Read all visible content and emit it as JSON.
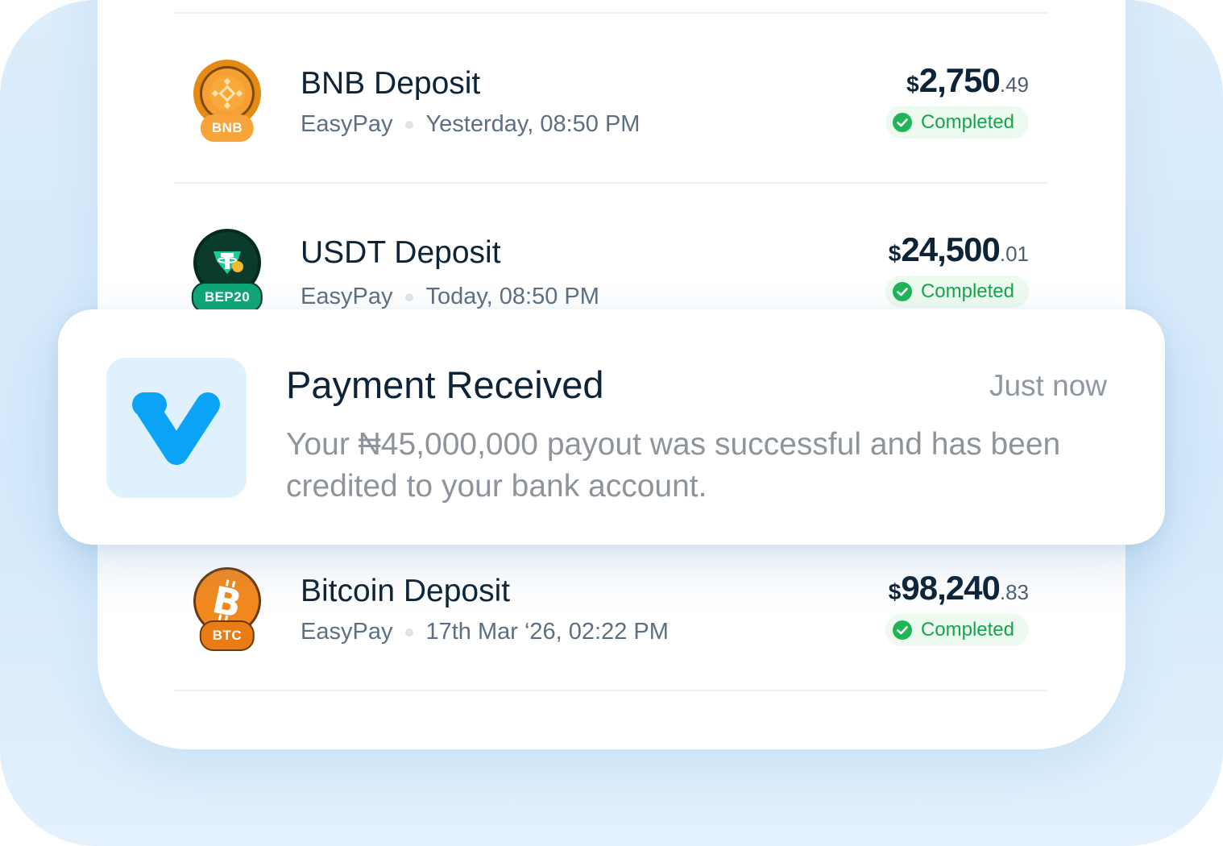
{
  "transactions": [
    {
      "title": "BNB Deposit",
      "source": "EasyPay",
      "time": "Yesterday, 08:50 PM",
      "currency_symbol": "$",
      "amount_whole": "2,750",
      "amount_cents": ".49",
      "status": "Completed",
      "coin_tag": "BNB",
      "coin_icon": "bnb-coin-icon"
    },
    {
      "title": "USDT Deposit",
      "source": "EasyPay",
      "time": "Today, 08:50 PM",
      "currency_symbol": "$",
      "amount_whole": "24,500",
      "amount_cents": ".01",
      "status": "Completed",
      "coin_tag": "BEP20",
      "coin_icon": "usdt-coin-icon"
    },
    {
      "title": "Bitcoin Deposit",
      "source": "EasyPay",
      "time": "17th Mar ‘26, 02:22 PM",
      "currency_symbol": "$",
      "amount_whole": "98,240",
      "amount_cents": ".83",
      "status": "Completed",
      "coin_tag": "BTC",
      "coin_icon": "bitcoin-coin-icon"
    }
  ],
  "notification": {
    "title": "Payment Received",
    "time": "Just now",
    "body": "Your ₦45,000,000 payout was successful and has been credited to your bank account.",
    "app_icon": "easypay-logo-icon"
  },
  "colors": {
    "navy_text": "#0d2337",
    "muted_text": "#5d6f82",
    "success_green": "#15a54b",
    "success_bg": "#edfaf0",
    "bnb_orange": "#f7931a",
    "usdt_green": "#0f9f73",
    "btc_orange": "#f2891e",
    "brand_blue": "#0aa3f5",
    "backdrop_blue": "#d6ebfb"
  }
}
